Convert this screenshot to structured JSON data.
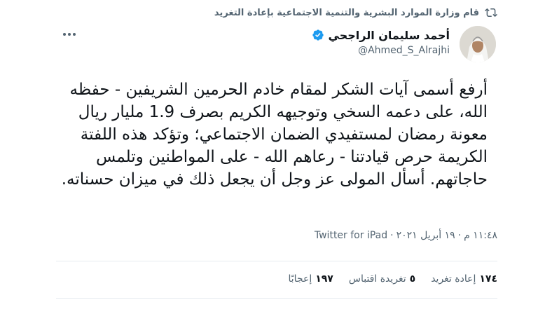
{
  "retweet": {
    "text": "قام وزارة الموارد البشرية والتنمية الاجتماعية بإعادة التغريد",
    "icon": "retweet-icon"
  },
  "author": {
    "name": "أحمد سليمان الراجحي",
    "handle": "@Ahmed_S_Alrajhi",
    "verified": true,
    "verified_color": "#1d9bf0"
  },
  "tweet": {
    "text": "أرفع أسمى آيات الشكر لمقام خادم الحرمين الشريفين - حفظه الله، على دعمه السخي وتوجيهه الكريم بصرف 1.9 مليار ريال معونة رمضان لمستفيدي الضمان الاجتماعي؛ وتؤكد هذه اللفتة الكريمة حرص قيادتنا - رعاهم الله - على المواطنين وتلمس حاجاتهم. أسأل المولى عز وجل أن يجعل ذلك في ميزان حسناته."
  },
  "meta": {
    "time": "١١:٤٨ م",
    "separator": "·",
    "date": "١٩ أبريل ٢٠٢١",
    "source": "Twitter for iPad"
  },
  "stats": {
    "retweets_count": "١٧٤",
    "retweets_label": "إعادة تغريد",
    "quotes_count": "٥",
    "quotes_label": "تغريدة اقتباس",
    "likes_count": "١٩٧",
    "likes_label": "إعجابًا"
  }
}
